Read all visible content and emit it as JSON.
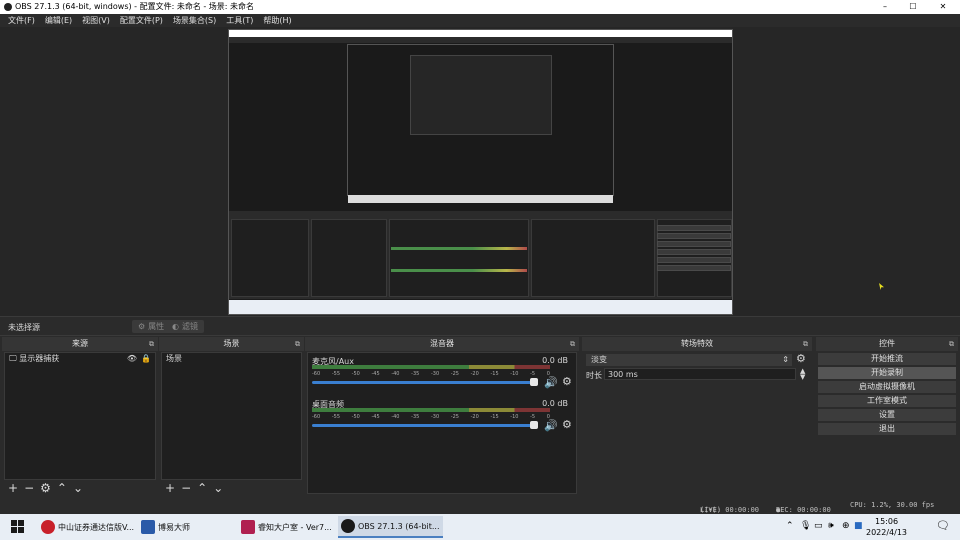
{
  "window": {
    "title": "OBS 27.1.3 (64-bit, windows) - 配置文件: 未命名 - 场景: 未命名",
    "minimize": "–",
    "maximize": "☐",
    "close": "✕"
  },
  "menu": [
    "文件(F)",
    "编辑(E)",
    "视图(V)",
    "配置文件(P)",
    "场景集合(S)",
    "工具(T)",
    "帮助(H)"
  ],
  "scene_bar": {
    "no_selection": "未选择源",
    "properties": "属性",
    "filters": "滤镜"
  },
  "sources": {
    "title": "来源",
    "items": [
      {
        "label": "显示器捕获"
      }
    ]
  },
  "scenes": {
    "title": "场景",
    "items": [
      {
        "label": "场景"
      }
    ]
  },
  "mixer": {
    "title": "混音器",
    "ticks": [
      "-60",
      "-55",
      "-50",
      "-45",
      "-40",
      "-35",
      "-30",
      "-25",
      "-20",
      "-15",
      "-10",
      "-5",
      "0"
    ],
    "channels": [
      {
        "name": "麦克风/Aux",
        "db": "0.0 dB"
      },
      {
        "name": "桌面音频",
        "db": "0.0 dB"
      }
    ]
  },
  "transitions": {
    "title": "转场特效",
    "type": "淡变",
    "duration_label": "时长",
    "duration_value": "300 ms"
  },
  "controls": {
    "title": "控件",
    "buttons": [
      "开始推流",
      "开始录制",
      "启动虚拟摄像机",
      "工作室模式",
      "设置",
      "退出"
    ]
  },
  "status": {
    "live": "LIVE: 00:00:00",
    "rec": "REC: 00:00:00",
    "cpu": "CPU: 1.2%, 30.00 fps"
  },
  "taskbar": {
    "apps": [
      {
        "label": "中山证券通达信版V...",
        "icon_color": "#c8202a"
      },
      {
        "label": "博易大师",
        "icon_color": "#2a5aa8"
      },
      {
        "label": "睿知大户室 - Ver7...",
        "icon_color": "#b02050"
      },
      {
        "label": "OBS 27.1.3 (64-bit...",
        "icon_color": "#1a1a1a"
      }
    ],
    "time": "15:06",
    "date": "2022/4/13"
  },
  "colors": {
    "background": "#2b2b2b",
    "panel": "#1f1f1f",
    "accent": "#3a7fd0",
    "meter_green": "#3e7d3e",
    "meter_yellow": "#8c8a37",
    "meter_red": "#7d3434"
  }
}
